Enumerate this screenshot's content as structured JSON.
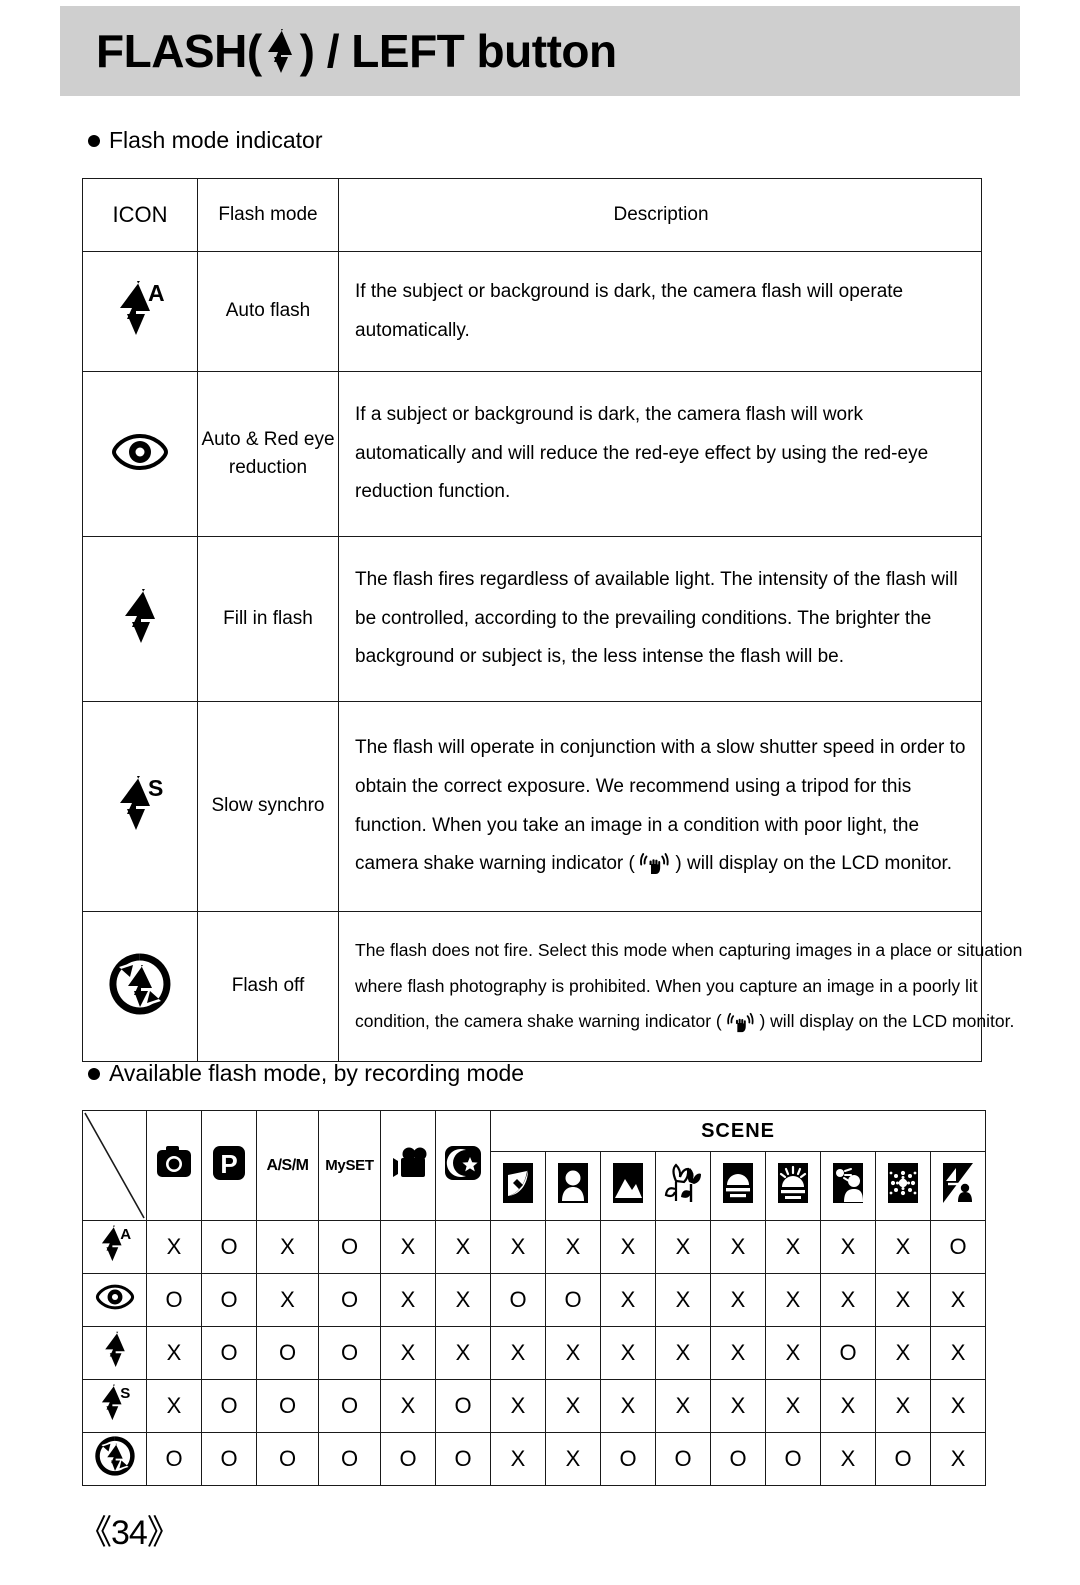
{
  "header": {
    "title_before": "FLASH(",
    "title_icon": "flash-bolt-icon",
    "title_after": ") / LEFT button",
    "banner_color": "#cfcfcf"
  },
  "section1": {
    "bullet_label": "Flash mode indicator",
    "table": {
      "headers": [
        "ICON",
        "Flash mode",
        "Description"
      ],
      "rows": [
        {
          "icon": "auto-flash-icon",
          "mode": "Auto flash",
          "description_lines": [
            "If the subject or background is dark, the camera flash will operate",
            "automatically."
          ]
        },
        {
          "icon": "red-eye-reduction-icon",
          "mode": "Auto & Red eye reduction",
          "mode_lines": [
            "Auto & Red eye",
            "reduction"
          ],
          "description_lines": [
            "If a subject or background is dark, the camera flash will work",
            "automatically and will reduce the red-eye effect by using the red-eye",
            "reduction function."
          ]
        },
        {
          "icon": "fill-in-flash-icon",
          "mode": "Fill in flash",
          "mode_lines": [
            "Fill in flash"
          ],
          "description_lines": [
            "The flash fires regardless of available light.  The intensity of the flash will",
            "be controlled, according to the prevailing conditions. The brighter the",
            "background or subject is, the less intense the flash will be."
          ]
        },
        {
          "icon": "slow-synchro-icon",
          "mode": "Slow synchro",
          "mode_lines": [
            "Slow synchro"
          ],
          "description_lines": [
            "The flash will operate in conjunction with a slow shutter speed in order to",
            "obtain the correct exposure. We recommend using a tripod for this",
            "function. When you take an image in a condition with poor light, the"
          ],
          "description_last_before": "camera shake warning indicator (",
          "description_last_icon": "camera-shake-warning-icon",
          "description_last_after": ") will display on the LCD monitor."
        },
        {
          "icon": "flash-off-icon",
          "mode": "Flash off",
          "mode_lines": [
            "Flash off"
          ],
          "description_lines": [
            "The flash does not fire. Select this mode when capturing images in a place or situation",
            "where flash photography is prohibited. When you capture an image in a poorly lit"
          ],
          "description_last_before": "condition, the camera shake warning indicator (",
          "description_last_icon": "camera-shake-warning-icon",
          "description_last_after": ") will display on the LCD monitor."
        }
      ]
    }
  },
  "section2": {
    "bullet_label": "Available flash mode, by recording mode",
    "scene_group_label": "SCENE",
    "columns": [
      {
        "id": "auto",
        "icon": "camera-auto-icon",
        "label": ""
      },
      {
        "id": "program",
        "icon": "program-p-icon",
        "label": ""
      },
      {
        "id": "asm",
        "icon": "",
        "label": "A/S/M"
      },
      {
        "id": "myset",
        "icon": "",
        "label": "MySET"
      },
      {
        "id": "movie",
        "icon": "movie-camera-icon",
        "label": ""
      },
      {
        "id": "night",
        "icon": "night-moon-star-icon",
        "label": ""
      },
      {
        "id": "scene-nightscene",
        "icon": "scene-nightscene-icon",
        "label": ""
      },
      {
        "id": "scene-portrait",
        "icon": "scene-portrait-icon",
        "label": ""
      },
      {
        "id": "scene-landscape",
        "icon": "scene-landscape-icon",
        "label": ""
      },
      {
        "id": "scene-closeup",
        "icon": "scene-closeup-icon",
        "label": ""
      },
      {
        "id": "scene-sunset",
        "icon": "scene-sunset-icon",
        "label": ""
      },
      {
        "id": "scene-dawn",
        "icon": "scene-dawn-icon",
        "label": ""
      },
      {
        "id": "scene-backlight",
        "icon": "scene-backlight-icon",
        "label": ""
      },
      {
        "id": "scene-fireworks",
        "icon": "scene-fireworks-icon",
        "label": ""
      },
      {
        "id": "scene-beachsnow",
        "icon": "scene-beachsnow-icon",
        "label": ""
      }
    ],
    "rows": [
      {
        "icon": "auto-flash-icon",
        "values": [
          "X",
          "O",
          "X",
          "O",
          "X",
          "X",
          "X",
          "X",
          "X",
          "X",
          "X",
          "X",
          "X",
          "X",
          "O"
        ]
      },
      {
        "icon": "red-eye-reduction-icon",
        "values": [
          "O",
          "O",
          "X",
          "O",
          "X",
          "X",
          "O",
          "O",
          "X",
          "X",
          "X",
          "X",
          "X",
          "X",
          "X"
        ]
      },
      {
        "icon": "fill-in-flash-icon",
        "values": [
          "X",
          "O",
          "O",
          "O",
          "X",
          "X",
          "X",
          "X",
          "X",
          "X",
          "X",
          "X",
          "O",
          "X",
          "X"
        ]
      },
      {
        "icon": "slow-synchro-icon",
        "values": [
          "X",
          "O",
          "O",
          "O",
          "X",
          "O",
          "X",
          "X",
          "X",
          "X",
          "X",
          "X",
          "X",
          "X",
          "X"
        ]
      },
      {
        "icon": "flash-off-icon",
        "values": [
          "O",
          "O",
          "O",
          "O",
          "O",
          "O",
          "X",
          "X",
          "O",
          "O",
          "O",
          "O",
          "X",
          "O",
          "X"
        ]
      }
    ]
  },
  "footer": {
    "page_number": "《34》"
  }
}
